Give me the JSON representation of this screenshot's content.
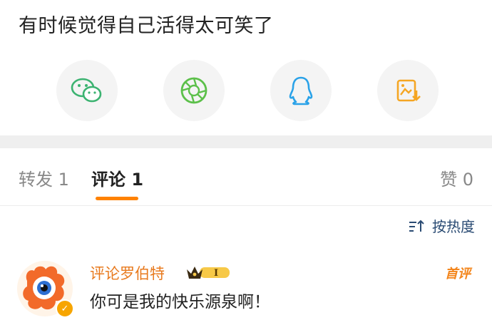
{
  "post": {
    "text": "有时候觉得自己活得太可笑了"
  },
  "share": {
    "items": [
      {
        "icon": "wechat-icon",
        "color": "#3cb371"
      },
      {
        "icon": "moments-icon",
        "color": "#5cc04a"
      },
      {
        "icon": "qq-icon",
        "color": "#2aa2e8"
      },
      {
        "icon": "save-image-icon",
        "color": "#f5a623"
      }
    ]
  },
  "tabs": {
    "repost": "转发 1",
    "comment": "评论 1",
    "like": "赞 0",
    "accent": "#ff8200"
  },
  "sort": {
    "label": "按热度"
  },
  "comments": [
    {
      "name": "评论罗伯特",
      "vip_level": "I",
      "tag": "首评",
      "text": "你可是我的快乐源泉啊！"
    }
  ]
}
